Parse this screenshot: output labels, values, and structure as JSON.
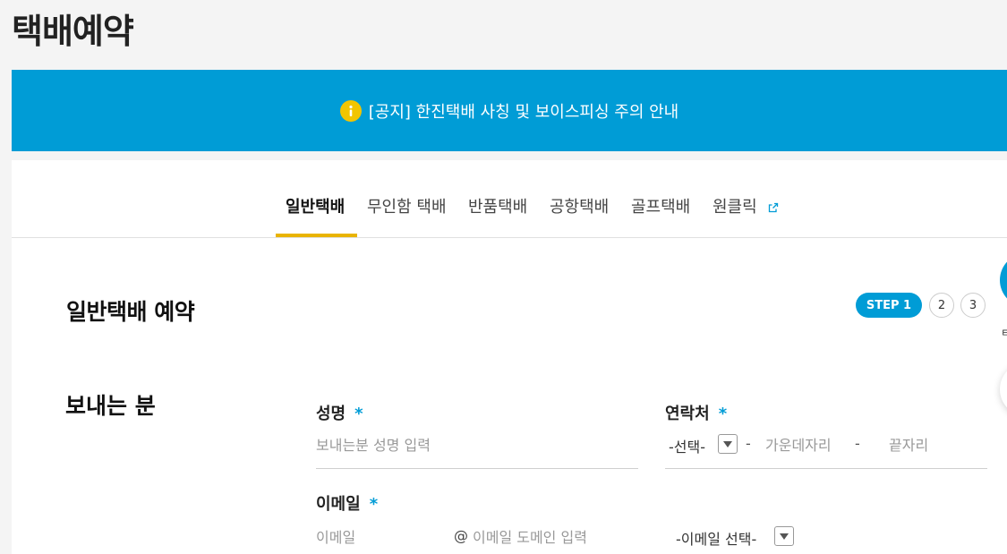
{
  "page": {
    "title": "택배예약"
  },
  "notice": {
    "text": "[공지] 한진택배 사칭 및 보이스피싱 주의 안내",
    "icon": "info-icon"
  },
  "tabs": [
    {
      "label": "일반택배",
      "active": true
    },
    {
      "label": "무인함 택배"
    },
    {
      "label": "반품택배"
    },
    {
      "label": "공항택배"
    },
    {
      "label": "골프택배"
    },
    {
      "label": "원클릭",
      "icon": "external-link-icon"
    }
  ],
  "section": {
    "title": "일반택배 예약"
  },
  "steps": [
    {
      "label": "STEP 1",
      "active": true
    },
    {
      "label": "2"
    },
    {
      "label": "3"
    }
  ],
  "sender": {
    "title": "보내는 분",
    "required_mark": "*",
    "name": {
      "label": "성명",
      "placeholder": "보내는분 성명 입력"
    },
    "phone": {
      "label": "연락처",
      "prefix_value": "-선택-",
      "separator": "-",
      "middle_placeholder": "가운데자리",
      "last_placeholder": "끝자리"
    },
    "email": {
      "label": "이메일",
      "id_placeholder": "이메일",
      "at": "@",
      "domain_placeholder": "이메일 도메인 입력",
      "domain_select_value": "-이메일 선택-"
    }
  },
  "side": {
    "label_partial": "ㅌ"
  },
  "colors": {
    "primary": "#009cd6",
    "accent": "#e9b400",
    "notice_icon": "#f2c500"
  }
}
